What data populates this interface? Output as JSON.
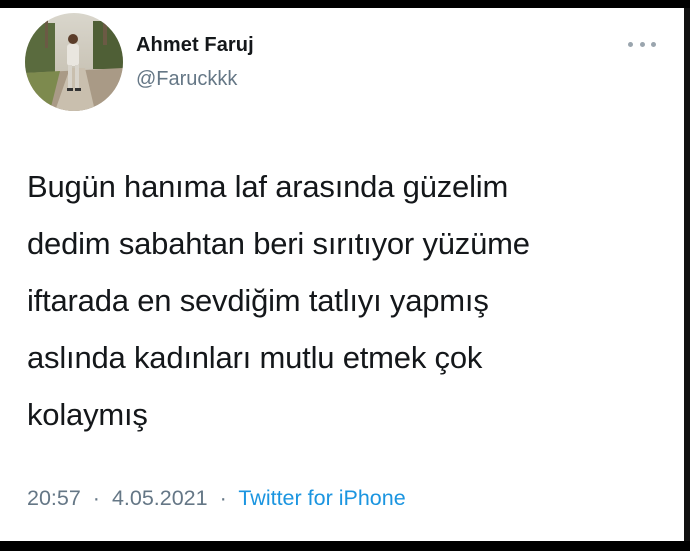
{
  "user": {
    "display_name": "Ahmet Faruj",
    "handle": "@Faruckkk"
  },
  "tweet": {
    "text": "Bugün hanıma laf arasında güzelim\ndedim sabahtan beri sırıtıyor yüzüme\niftarada en sevdiğim tatlıyı yapmış\naslında kadınları mutlu etmek çok\nkolaymış",
    "time": "20:57",
    "date": "4.05.2021",
    "separator": "·",
    "source": "Twitter for iPhone"
  },
  "icons": {
    "more": "more-horizontal-icon",
    "avatar": "user-avatar"
  }
}
